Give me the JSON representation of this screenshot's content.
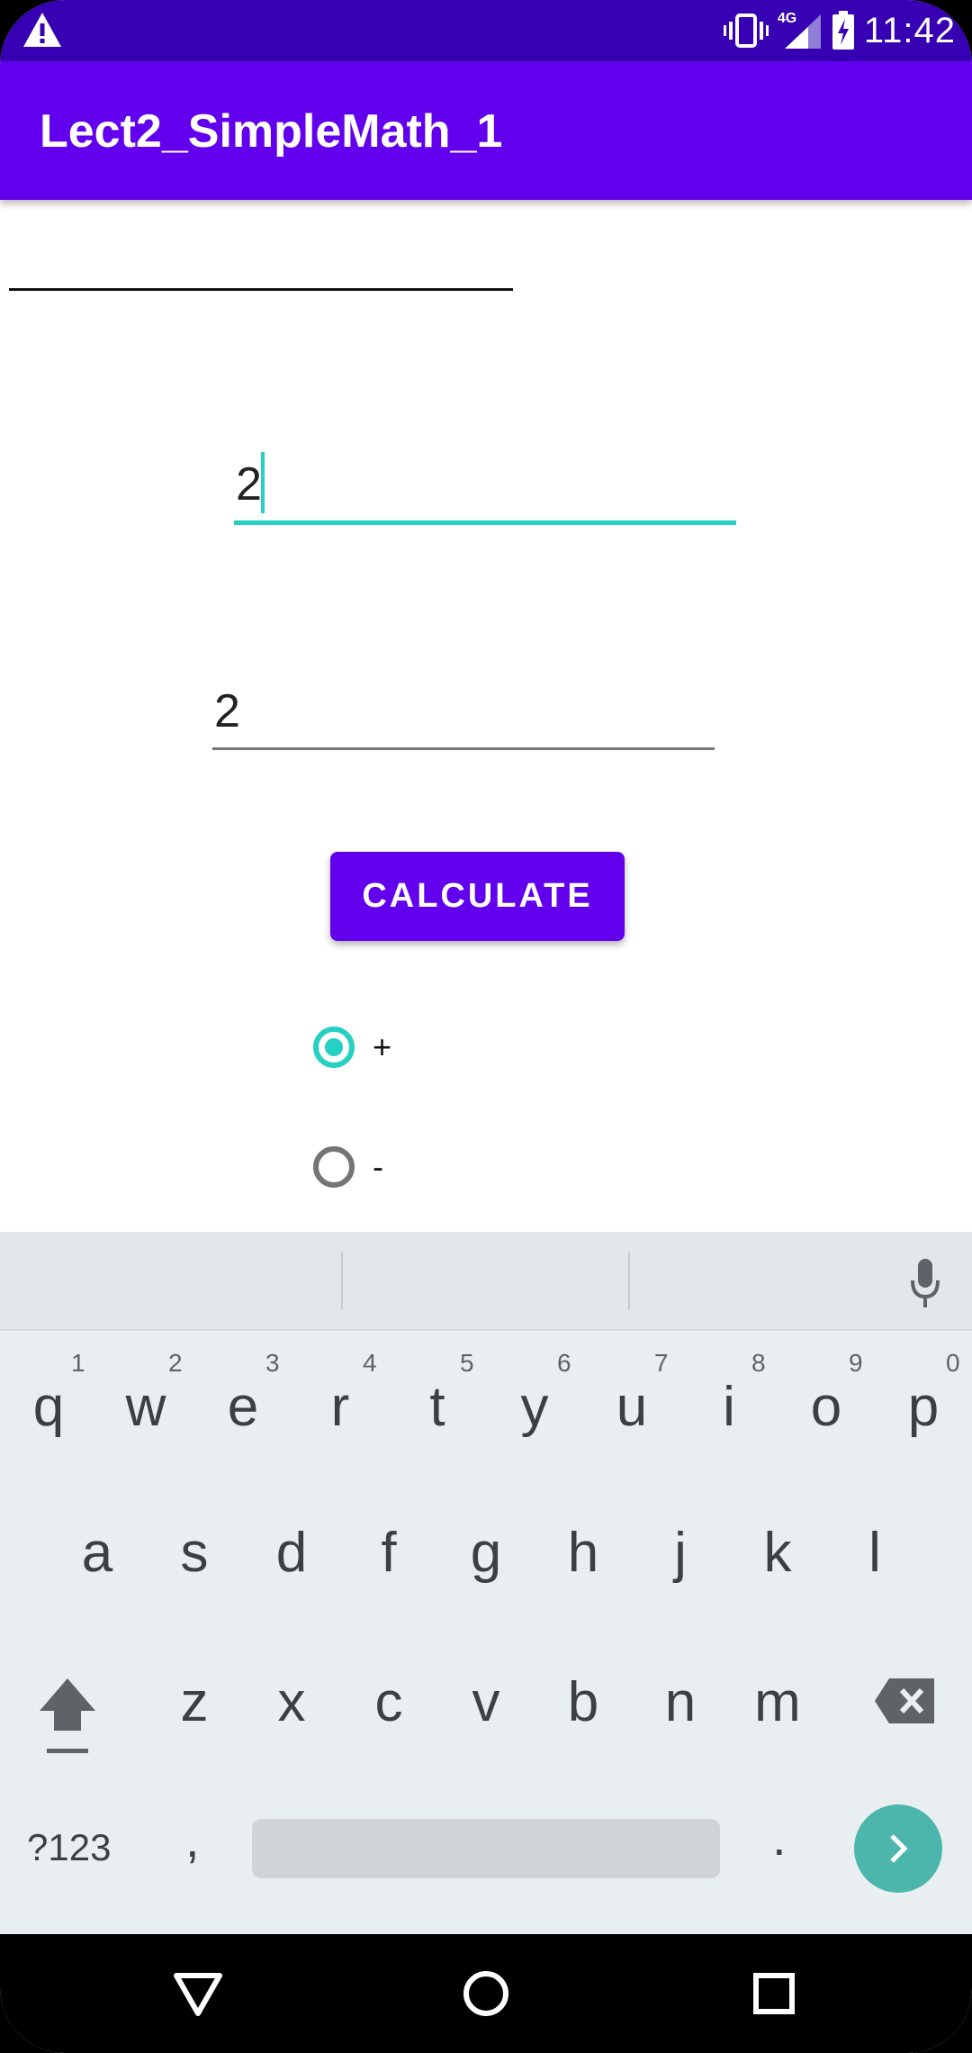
{
  "status_bar": {
    "time": "11:42",
    "network": "4G"
  },
  "app_bar": {
    "title": "Lect2_SimpleMath_1"
  },
  "inputs": {
    "first_number": "2",
    "second_number": "2"
  },
  "calculate_button": {
    "label": "CALCULATE"
  },
  "operations": [
    {
      "label": "+",
      "checked": true
    },
    {
      "label": "-",
      "checked": false
    }
  ],
  "keyboard": {
    "row1": [
      {
        "key": "q",
        "hint": "1"
      },
      {
        "key": "w",
        "hint": "2"
      },
      {
        "key": "e",
        "hint": "3"
      },
      {
        "key": "r",
        "hint": "4"
      },
      {
        "key": "t",
        "hint": "5"
      },
      {
        "key": "y",
        "hint": "6"
      },
      {
        "key": "u",
        "hint": "7"
      },
      {
        "key": "i",
        "hint": "8"
      },
      {
        "key": "o",
        "hint": "9"
      },
      {
        "key": "p",
        "hint": "0"
      }
    ],
    "row2": [
      "a",
      "s",
      "d",
      "f",
      "g",
      "h",
      "j",
      "k",
      "l"
    ],
    "row3": [
      "z",
      "x",
      "c",
      "v",
      "b",
      "n",
      "m"
    ],
    "symbols_key": "?123",
    "comma_key": ",",
    "period_key": "."
  },
  "colors": {
    "primary": "#6200ee",
    "primary_dark": "#3700b3",
    "accent": "#26d0c3"
  }
}
